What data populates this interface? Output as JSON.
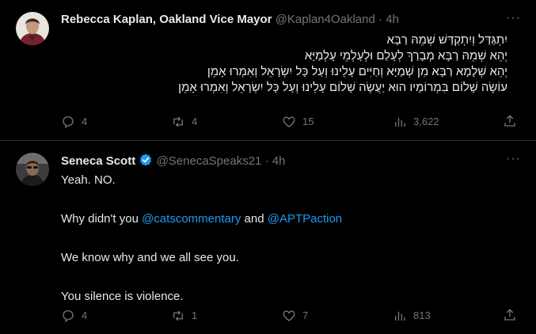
{
  "tweets": [
    {
      "name": "Rebecca Kaplan, Oakland Vice Mayor",
      "handle": "@Kaplan4Oakland",
      "dot": "·",
      "time": "4h",
      "lines": [
        "יִתְגַּדַּל וְיִתְקַדַּשׁ שְׁמֵהּ רַבָּא",
        "יְהֵא שְׁמֵהּ רַבָּא מְבָרַךְ לְעָלַם וּלְעָלְמֵי עָלְמַיָּא",
        "יְהֵא שְׁלָמָא רַבָּא מִן שְׁמַיָּא וְחַיִּים עָלֵינוּ וְעַל כָּל יִשְׂרָאֵל וְאִמְרוּ אָמֵן",
        "עוֹשֶׂה  שָׁלוֹם בִּמְרוֹמָיו הוּא יַעֲשֶׂה שָׁלוֹם עָלֵינוּ וְעַל כָּל יִשְׂרָאֵל וְאִמְרוּ אָמֵן"
      ],
      "replies": "4",
      "reposts": "4",
      "likes": "15",
      "views": "3,622"
    },
    {
      "name": "Seneca Scott",
      "handle": "@SenecaSpeaks21",
      "dot": "·",
      "time": "4h",
      "line1": "Yeah.  NO.",
      "line2_pre": "Why didn't you ",
      "mention1": "@catscommentary",
      "line2_mid": " and ",
      "mention2": "@APTPaction",
      "line3": "We know why and we all see you.",
      "line4": "You silence is violence.",
      "replies": "4",
      "reposts": "1",
      "likes": "7",
      "views": "813"
    }
  ],
  "more_glyph": "···",
  "colors": {
    "accent": "#1d9bf0",
    "muted": "#71767b",
    "text": "#e7e9ea",
    "verified": "#1d9bf0"
  }
}
